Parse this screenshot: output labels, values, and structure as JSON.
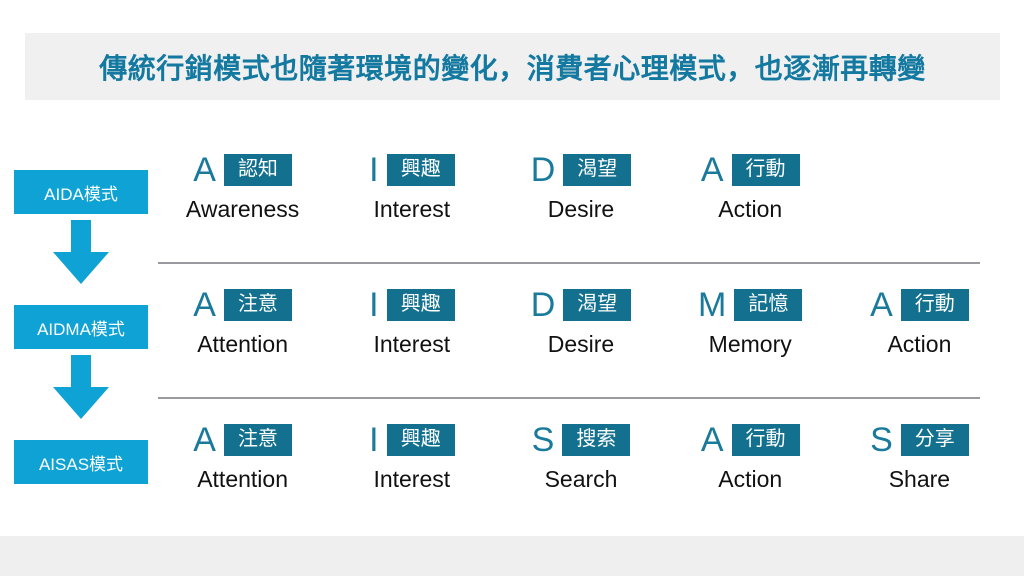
{
  "header": {
    "title": "傳統行銷模式也隨著環境的變化，消費者心理模式，也逐漸再轉變",
    "band_color": "#F0F0F0",
    "title_color": "#1479A0"
  },
  "colors": {
    "model_label_blue": "#0FA2D4",
    "step_badge_teal": "#13718F",
    "step_letter_teal": "#1A7A9C",
    "arrow_blue": "#0FA2D4",
    "divider_gray": "#9A9A9E",
    "footer_gray": "#EFEFEF",
    "english_text": "#111111"
  },
  "rows": [
    {
      "id": "aida",
      "label": "AIDA模式",
      "steps": [
        {
          "letter": "A",
          "badge": "認知",
          "english": "Awareness"
        },
        {
          "letter": "I",
          "badge": "興趣",
          "english": "Interest"
        },
        {
          "letter": "D",
          "badge": "渴望",
          "english": "Desire"
        },
        {
          "letter": "A",
          "badge": "行動",
          "english": "Action"
        }
      ]
    },
    {
      "id": "aidma",
      "label": "AIDMA模式",
      "steps": [
        {
          "letter": "A",
          "badge": "注意",
          "english": "Attention"
        },
        {
          "letter": "I",
          "badge": "興趣",
          "english": "Interest"
        },
        {
          "letter": "D",
          "badge": "渴望",
          "english": "Desire"
        },
        {
          "letter": "M",
          "badge": "記憶",
          "english": "Memory"
        },
        {
          "letter": "A",
          "badge": "行動",
          "english": "Action"
        }
      ]
    },
    {
      "id": "aisas",
      "label": "AISAS模式",
      "steps": [
        {
          "letter": "A",
          "badge": "注意",
          "english": "Attention"
        },
        {
          "letter": "I",
          "badge": "興趣",
          "english": "Interest"
        },
        {
          "letter": "S",
          "badge": "搜索",
          "english": "Search"
        },
        {
          "letter": "A",
          "badge": "行動",
          "english": "Action"
        },
        {
          "letter": "S",
          "badge": "分享",
          "english": "Share"
        }
      ]
    }
  ],
  "arrows": [
    {
      "name": "arrow-aida-to-aidma",
      "icon": "arrow-down-icon"
    },
    {
      "name": "arrow-aidma-to-aisas",
      "icon": "arrow-down-icon"
    }
  ]
}
